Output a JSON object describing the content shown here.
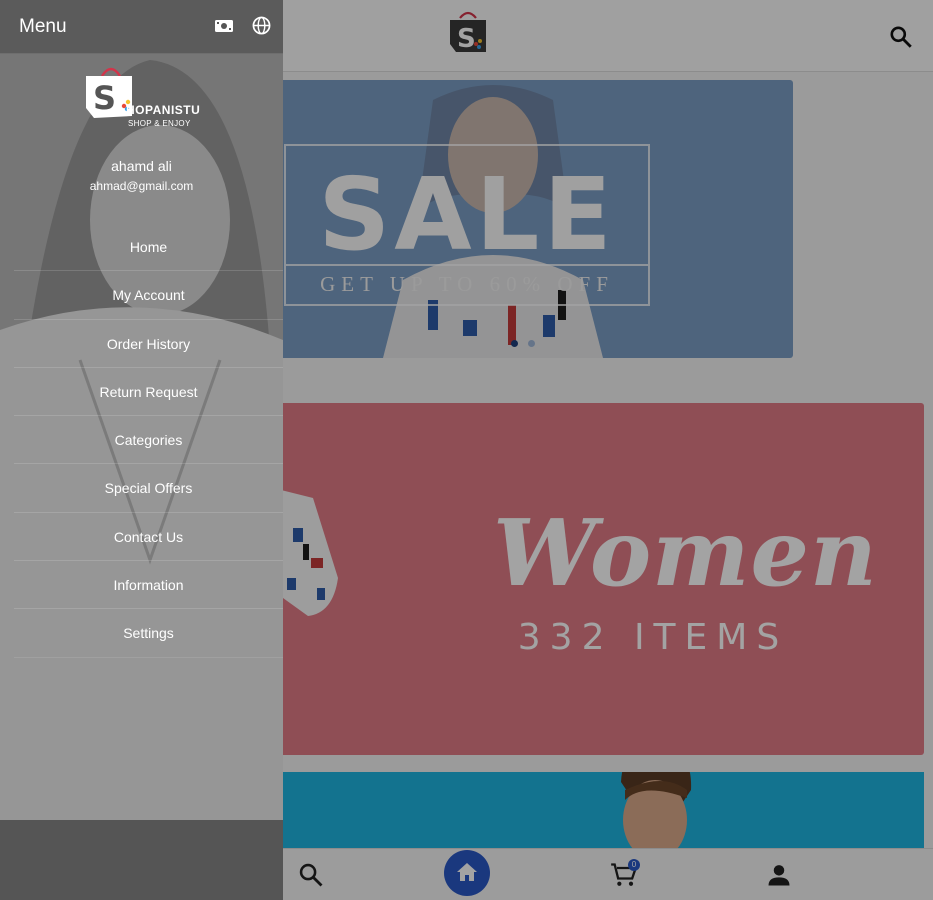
{
  "drawer": {
    "title": "Menu",
    "icons": [
      "money-icon",
      "globe-icon"
    ],
    "brand": {
      "name": "HOPANISTU",
      "tagline": "SHOP & ENJOY"
    },
    "user": {
      "name": "ahamd ali",
      "email": "ahmad@gmail.com"
    },
    "items": [
      {
        "label": "Home"
      },
      {
        "label": "My Account"
      },
      {
        "label": "Order History"
      },
      {
        "label": "Return Request"
      },
      {
        "label": "Categories"
      },
      {
        "label": "Special Offers"
      },
      {
        "label": "Contact Us"
      },
      {
        "label": "Information"
      },
      {
        "label": "Settings"
      }
    ]
  },
  "banners": {
    "sale": {
      "title": "SALE",
      "subtitle": "GET UP TO 60% OFF"
    },
    "women": {
      "title": "Women",
      "count": "332 ITEMS"
    }
  },
  "bottom_nav": {
    "items": [
      "search-icon",
      "home-icon",
      "cart-icon",
      "account-icon"
    ],
    "cart_badge": "0"
  },
  "colors": {
    "accent": "#2a58c6",
    "sale_banner": "#7b9dc4",
    "women_banner": "#e07b85",
    "men_banner": "#1fb4e0"
  }
}
